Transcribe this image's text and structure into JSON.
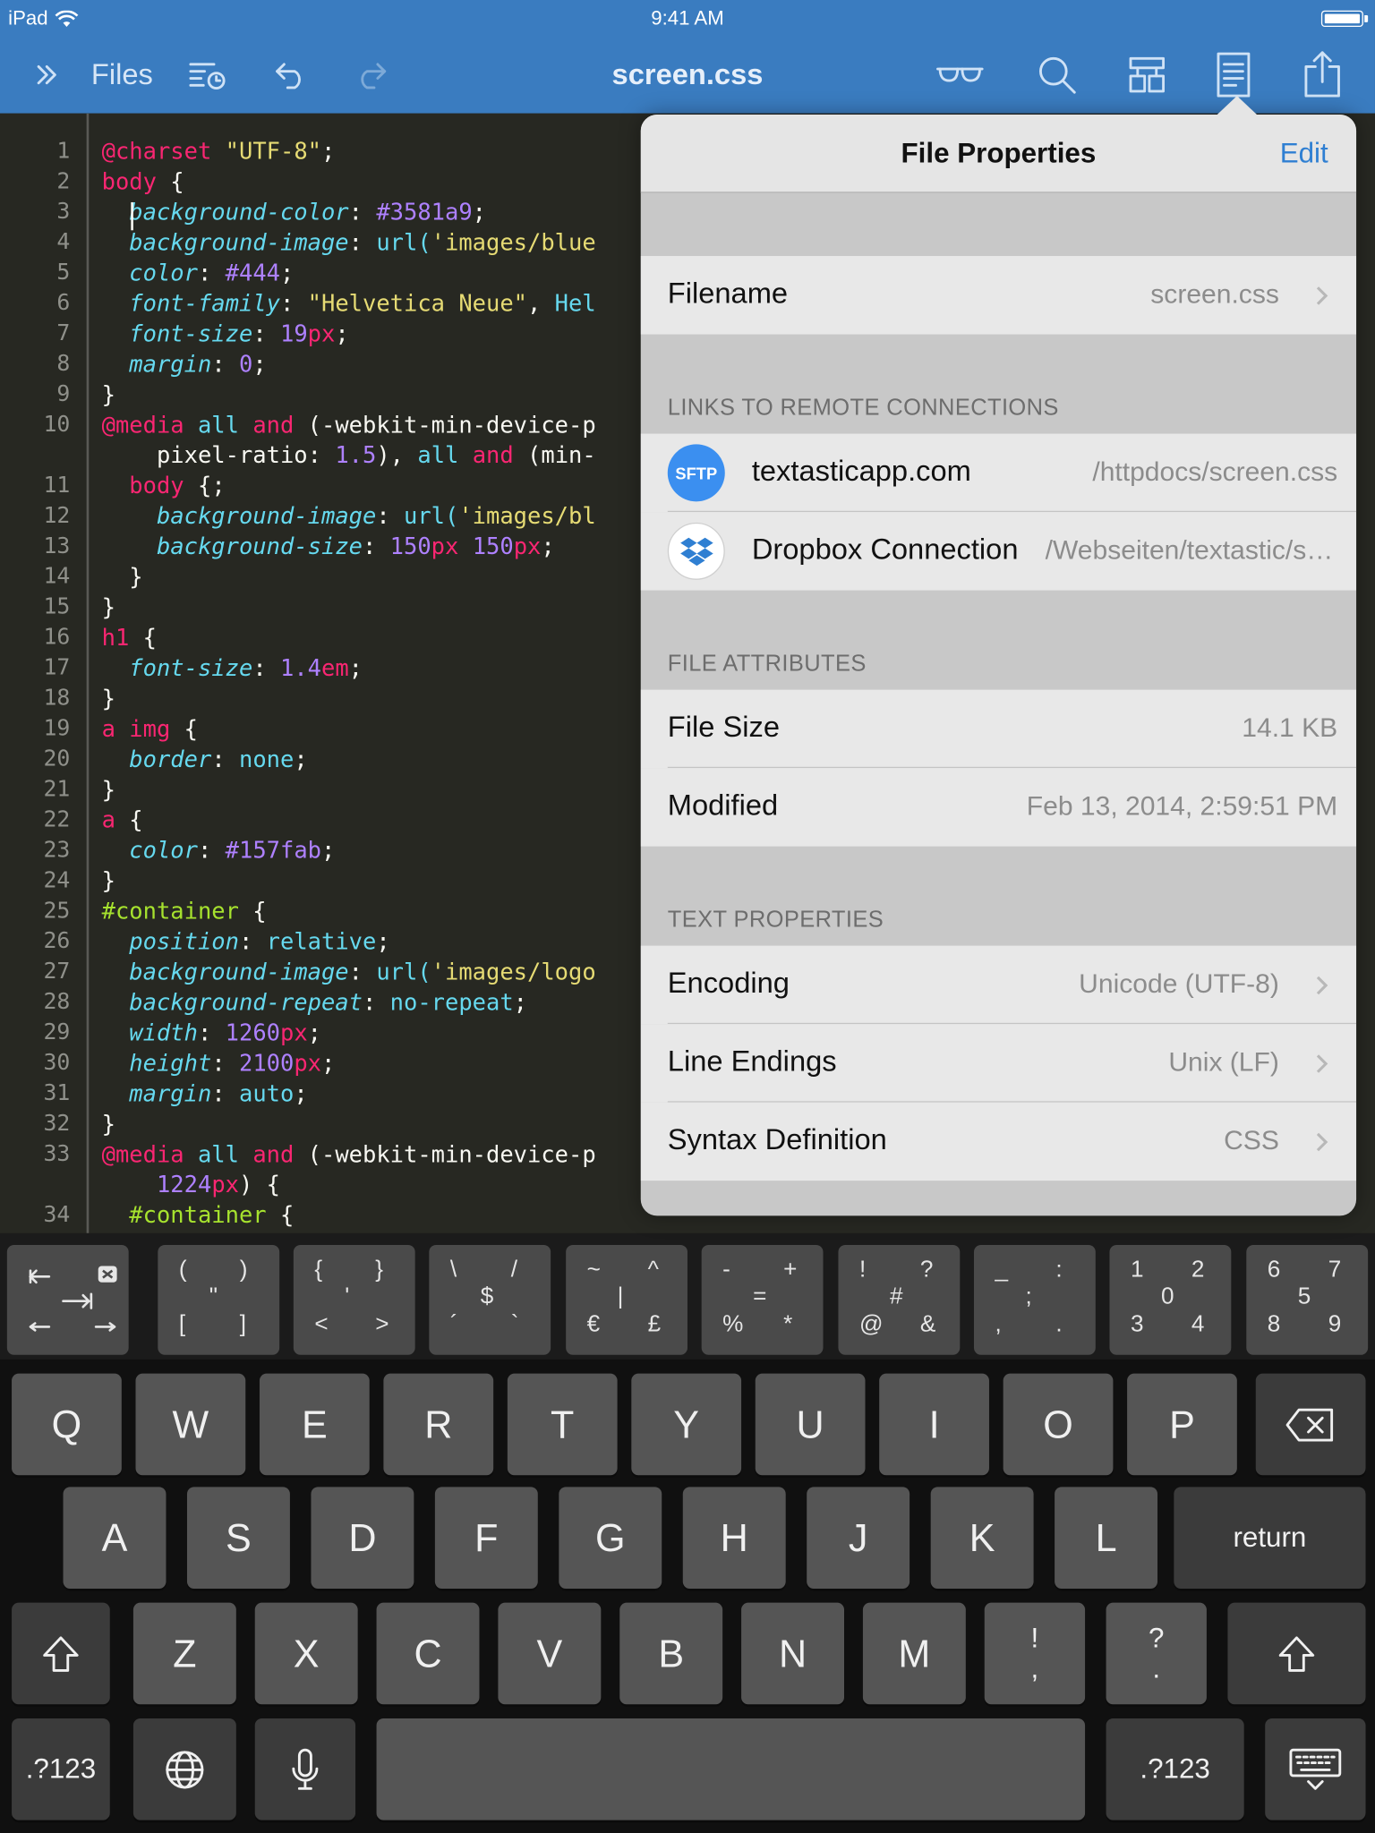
{
  "status": {
    "carrier": "iPad",
    "time": "9:41 AM"
  },
  "toolbar": {
    "files_label": "Files",
    "title": "screen.css"
  },
  "editor": {
    "lines": [
      {
        "n": "1",
        "t": 131,
        "h": [
          [
            "k",
            "@charset "
          ],
          [
            "s",
            "\"UTF-8\""
          ],
          [
            "",
            ";"
          ]
        ]
      },
      {
        "n": "2",
        "t": 157,
        "h": [
          [
            "k",
            "body"
          ],
          [
            "",
            " {"
          ]
        ]
      },
      {
        "n": "3",
        "t": 183,
        "h": [
          [
            "",
            "  "
          ],
          [
            "p",
            "background-color"
          ],
          [
            "",
            ": "
          ],
          [
            "n",
            "#3581a9"
          ],
          [
            "",
            ";"
          ]
        ]
      },
      {
        "n": "4",
        "t": 209,
        "h": [
          [
            "",
            "  "
          ],
          [
            "p",
            "background-image"
          ],
          [
            "",
            ": "
          ],
          [
            "v",
            "url("
          ],
          [
            "s",
            "'images/blue"
          ]
        ]
      },
      {
        "n": "5",
        "t": 235,
        "h": [
          [
            "",
            "  "
          ],
          [
            "p",
            "color"
          ],
          [
            "",
            ": "
          ],
          [
            "n",
            "#444"
          ],
          [
            "",
            ";"
          ]
        ]
      },
      {
        "n": "6",
        "t": 261,
        "h": [
          [
            "",
            "  "
          ],
          [
            "p",
            "font-family"
          ],
          [
            "",
            ": "
          ],
          [
            "s",
            "\"Helvetica Neue\""
          ],
          [
            "",
            ", "
          ],
          [
            "v",
            "Hel"
          ]
        ]
      },
      {
        "n": "7",
        "t": 287,
        "h": [
          [
            "",
            "  "
          ],
          [
            "p",
            "font-size"
          ],
          [
            "",
            ": "
          ],
          [
            "n",
            "19"
          ],
          [
            "u",
            "px"
          ],
          [
            "",
            ";"
          ]
        ]
      },
      {
        "n": "8",
        "t": 313,
        "h": [
          [
            "",
            "  "
          ],
          [
            "p",
            "margin"
          ],
          [
            "",
            ": "
          ],
          [
            "n",
            "0"
          ],
          [
            "",
            ";"
          ]
        ]
      },
      {
        "n": "9",
        "t": 339,
        "h": [
          [
            "",
            "}"
          ]
        ]
      },
      {
        "n": "10",
        "t": 365,
        "h": [
          [
            "k",
            "@media "
          ],
          [
            "v",
            "all "
          ],
          [
            "k",
            "and"
          ],
          [
            "",
            " (-webkit-min-device-p"
          ]
        ]
      },
      {
        "n": "",
        "t": 391,
        "h": [
          [
            "",
            "    pixel-ratio: "
          ],
          [
            "n",
            "1.5"
          ],
          [
            "",
            "), "
          ],
          [
            "v",
            "all "
          ],
          [
            "k",
            "and"
          ],
          [
            "",
            " (min-"
          ]
        ]
      },
      {
        "n": "11",
        "t": 417,
        "h": [
          [
            "",
            "  "
          ],
          [
            "k",
            "body"
          ],
          [
            "",
            " {;"
          ]
        ]
      },
      {
        "n": "12",
        "t": 443,
        "h": [
          [
            "",
            "    "
          ],
          [
            "p",
            "background-image"
          ],
          [
            "",
            ": "
          ],
          [
            "v",
            "url("
          ],
          [
            "s",
            "'images/bl"
          ]
        ]
      },
      {
        "n": "13",
        "t": 469,
        "h": [
          [
            "",
            "    "
          ],
          [
            "p",
            "background-size"
          ],
          [
            "",
            ": "
          ],
          [
            "n",
            "150"
          ],
          [
            "u",
            "px"
          ],
          [
            "",
            " "
          ],
          [
            "n",
            "150"
          ],
          [
            "u",
            "px"
          ],
          [
            "",
            ";"
          ]
        ]
      },
      {
        "n": "14",
        "t": 495,
        "h": [
          [
            "",
            "  }"
          ]
        ]
      },
      {
        "n": "15",
        "t": 521,
        "h": [
          [
            "",
            "}"
          ]
        ]
      },
      {
        "n": "16",
        "t": 547,
        "h": [
          [
            "k",
            "h1"
          ],
          [
            "",
            " {"
          ]
        ]
      },
      {
        "n": "17",
        "t": 573,
        "h": [
          [
            "",
            "  "
          ],
          [
            "p",
            "font-size"
          ],
          [
            "",
            ": "
          ],
          [
            "n",
            "1.4"
          ],
          [
            "u",
            "em"
          ],
          [
            "",
            ";"
          ]
        ]
      },
      {
        "n": "18",
        "t": 599,
        "h": [
          [
            "",
            "}"
          ]
        ]
      },
      {
        "n": "19",
        "t": 625,
        "h": [
          [
            "k",
            "a img"
          ],
          [
            "",
            " {"
          ]
        ]
      },
      {
        "n": "20",
        "t": 651,
        "h": [
          [
            "",
            "  "
          ],
          [
            "p",
            "border"
          ],
          [
            "",
            ": "
          ],
          [
            "v",
            "none"
          ],
          [
            "",
            ";"
          ]
        ]
      },
      {
        "n": "21",
        "t": 677,
        "h": [
          [
            "",
            "}"
          ]
        ]
      },
      {
        "n": "22",
        "t": 703,
        "h": [
          [
            "k",
            "a"
          ],
          [
            "",
            " {"
          ]
        ]
      },
      {
        "n": "23",
        "t": 729,
        "h": [
          [
            "",
            "  "
          ],
          [
            "p",
            "color"
          ],
          [
            "",
            ": "
          ],
          [
            "n",
            "#157fab"
          ],
          [
            "",
            ";"
          ]
        ]
      },
      {
        "n": "24",
        "t": 755,
        "h": [
          [
            "",
            "}"
          ]
        ]
      },
      {
        "n": "25",
        "t": 781,
        "h": [
          [
            "sel",
            "#container"
          ],
          [
            "",
            " {"
          ]
        ]
      },
      {
        "n": "26",
        "t": 807,
        "h": [
          [
            "",
            "  "
          ],
          [
            "p",
            "position"
          ],
          [
            "",
            ": "
          ],
          [
            "v",
            "relative"
          ],
          [
            "",
            ";"
          ]
        ]
      },
      {
        "n": "27",
        "t": 833,
        "h": [
          [
            "",
            "  "
          ],
          [
            "p",
            "background-image"
          ],
          [
            "",
            ": "
          ],
          [
            "v",
            "url("
          ],
          [
            "s",
            "'images/logo"
          ]
        ]
      },
      {
        "n": "28",
        "t": 859,
        "h": [
          [
            "",
            "  "
          ],
          [
            "p",
            "background-repeat"
          ],
          [
            "",
            ": "
          ],
          [
            "v",
            "no-repeat"
          ],
          [
            "",
            ";"
          ]
        ]
      },
      {
        "n": "29",
        "t": 885,
        "h": [
          [
            "",
            "  "
          ],
          [
            "p",
            "width"
          ],
          [
            "",
            ": "
          ],
          [
            "n",
            "1260"
          ],
          [
            "u",
            "px"
          ],
          [
            "",
            ";"
          ]
        ]
      },
      {
        "n": "30",
        "t": 911,
        "h": [
          [
            "",
            "  "
          ],
          [
            "p",
            "height"
          ],
          [
            "",
            ": "
          ],
          [
            "n",
            "2100"
          ],
          [
            "u",
            "px"
          ],
          [
            "",
            ";"
          ]
        ]
      },
      {
        "n": "31",
        "t": 937,
        "h": [
          [
            "",
            "  "
          ],
          [
            "p",
            "margin"
          ],
          [
            "",
            ": "
          ],
          [
            "v",
            "auto"
          ],
          [
            "",
            ";"
          ]
        ]
      },
      {
        "n": "32",
        "t": 963,
        "h": [
          [
            "",
            "}"
          ]
        ]
      },
      {
        "n": "33",
        "t": 989,
        "h": [
          [
            "k",
            "@media "
          ],
          [
            "v",
            "all "
          ],
          [
            "k",
            "and"
          ],
          [
            "",
            " (-webkit-min-device-p"
          ]
        ]
      },
      {
        "n": "",
        "t": 1015,
        "h": [
          [
            "",
            "    "
          ],
          [
            "n",
            "1224"
          ],
          [
            "u",
            "px"
          ],
          [
            "",
            ") {"
          ]
        ]
      },
      {
        "n": "34",
        "t": 1041,
        "h": [
          [
            "",
            "  "
          ],
          [
            "sel",
            "#container"
          ],
          [
            "",
            " {"
          ]
        ]
      }
    ]
  },
  "popover": {
    "title": "File Properties",
    "edit": "Edit",
    "filename": {
      "label": "Filename",
      "value": "screen.css"
    },
    "links_header": "LINKS TO REMOTE CONNECTIONS",
    "connections": [
      {
        "badge": "SFTP",
        "name": "textasticapp.com",
        "path": "/httpdocs/screen.css"
      },
      {
        "badge": "",
        "name": "Dropbox Connection",
        "path": "/Webseiten/textastic/screen.css"
      }
    ],
    "attrs_header": "FILE ATTRIBUTES",
    "file_size": {
      "label": "File Size",
      "value": "14.1 KB"
    },
    "modified": {
      "label": "Modified",
      "value": "Feb 13, 2014, 2:59:51 PM"
    },
    "text_header": "TEXT PROPERTIES",
    "encoding": {
      "label": "Encoding",
      "value": "Unicode (UTF-8)"
    },
    "line_endings": {
      "label": "Line Endings",
      "value": "Unix (LF)"
    },
    "syntax": {
      "label": "Syntax Definition",
      "value": "CSS"
    }
  },
  "keyboard": {
    "extra_keys": [
      {
        "c": "(",
        "d": ")",
        "e": "\"",
        "f": "[",
        "g": "]"
      },
      {
        "c": "{",
        "d": "}",
        "e": "'",
        "f": "<",
        "g": ">"
      },
      {
        "c": "\\",
        "d": "/",
        "e": "$",
        "f": "´",
        "g": "`"
      },
      {
        "c": "~",
        "d": "^",
        "e": "|",
        "f": "€",
        "g": "£"
      },
      {
        "c": "-",
        "d": "+",
        "e": "=",
        "f": "%",
        "g": "*"
      },
      {
        "c": "!",
        "d": "?",
        "e": "#",
        "f": "@",
        "g": "&"
      },
      {
        "c": "_",
        "d": ":",
        "e": ";",
        "f": ",",
        "g": "."
      },
      {
        "c": "1",
        "d": "2",
        "e": "0",
        "f": "3",
        "g": "4"
      },
      {
        "c": "6",
        "d": "7",
        "e": "5",
        "f": "8",
        "g": "9"
      }
    ],
    "row1": [
      "Q",
      "W",
      "E",
      "R",
      "T",
      "Y",
      "U",
      "I",
      "O",
      "P"
    ],
    "row2": [
      "A",
      "S",
      "D",
      "F",
      "G",
      "H",
      "J",
      "K",
      "L"
    ],
    "row3": [
      "Z",
      "X",
      "C",
      "V",
      "B",
      "N",
      "M"
    ],
    "punct1": {
      "top": "!",
      "bottom": ","
    },
    "punct2": {
      "top": "?",
      "bottom": "."
    },
    "return_label": "return",
    "num_label": ".?123"
  }
}
